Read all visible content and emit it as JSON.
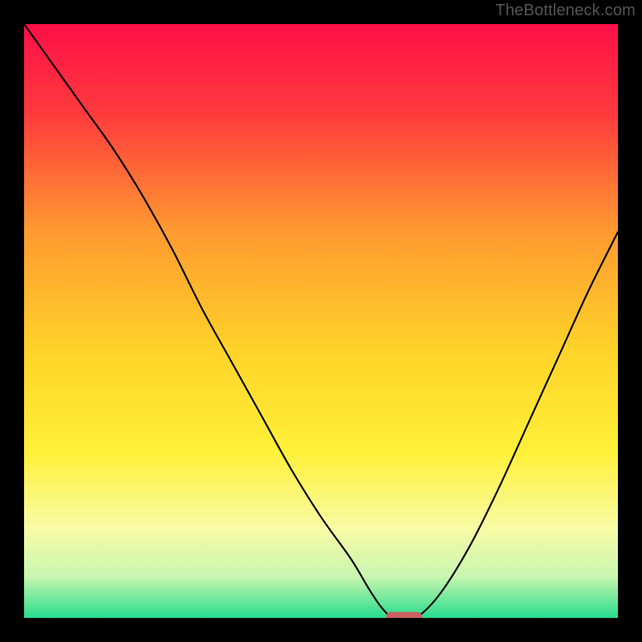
{
  "watermark": "TheBottleneck.com",
  "chart_data": {
    "type": "line",
    "title": "",
    "xlabel": "",
    "ylabel": "",
    "xlim": [
      0,
      100
    ],
    "ylim": [
      0,
      100
    ],
    "grid": false,
    "legend": false,
    "background": "rainbow-gradient",
    "gradient_stops": [
      {
        "pos": 0.0,
        "color": "#ff0f48"
      },
      {
        "pos": 0.15,
        "color": "#ff3a3d"
      },
      {
        "pos": 0.35,
        "color": "#ff9a30"
      },
      {
        "pos": 0.55,
        "color": "#ffd329"
      },
      {
        "pos": 0.72,
        "color": "#fff038"
      },
      {
        "pos": 0.85,
        "color": "#f8fba5"
      },
      {
        "pos": 0.93,
        "color": "#c9f6b0"
      },
      {
        "pos": 0.97,
        "color": "#6de79a"
      },
      {
        "pos": 1.0,
        "color": "#26dc90"
      }
    ],
    "series": [
      {
        "name": "bottleneck-curve",
        "x": [
          0,
          5,
          10,
          15,
          20,
          25,
          30,
          35,
          40,
          45,
          50,
          55,
          58,
          60,
          62,
          64,
          66,
          70,
          75,
          80,
          85,
          90,
          95,
          100
        ],
        "y": [
          100,
          93,
          86,
          79,
          71,
          62,
          52,
          43,
          34,
          25,
          17,
          10,
          5,
          2,
          0,
          0,
          0,
          4,
          12,
          22,
          33,
          44,
          55,
          65
        ]
      }
    ],
    "marker": {
      "name": "optimal-point",
      "x_range": [
        61,
        67
      ],
      "y": 0,
      "color": "#c9605f"
    }
  }
}
